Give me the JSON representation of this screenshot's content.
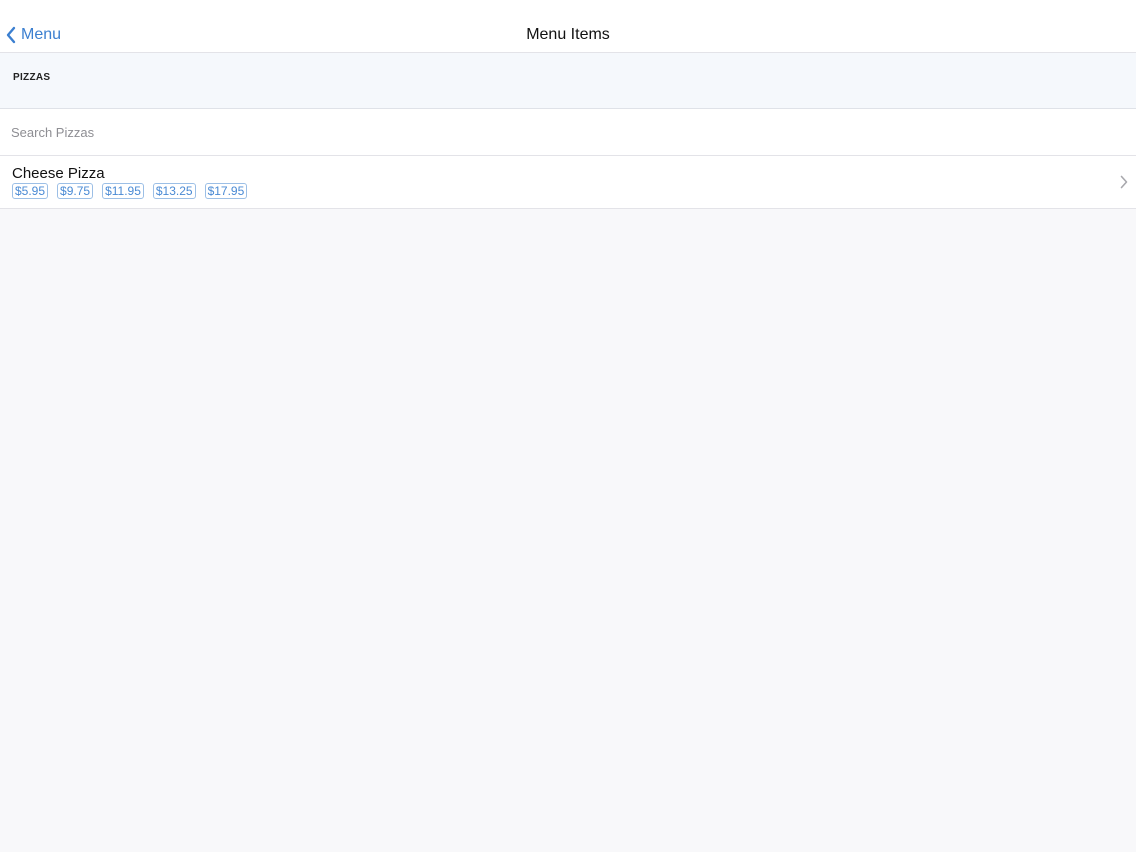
{
  "navbar": {
    "back_label": "Menu",
    "title": "Menu Items"
  },
  "section": {
    "title": "PIZZAS"
  },
  "search": {
    "placeholder": "Search Pizzas",
    "value": ""
  },
  "items": [
    {
      "name": "Cheese Pizza",
      "prices": [
        "$5.95",
        "$9.75",
        "$11.95",
        "$13.25",
        "$17.95"
      ]
    }
  ],
  "colors": {
    "accent": "#3b7fd0",
    "badge_border": "#9cbfe6",
    "background": "#f8f8fa"
  }
}
